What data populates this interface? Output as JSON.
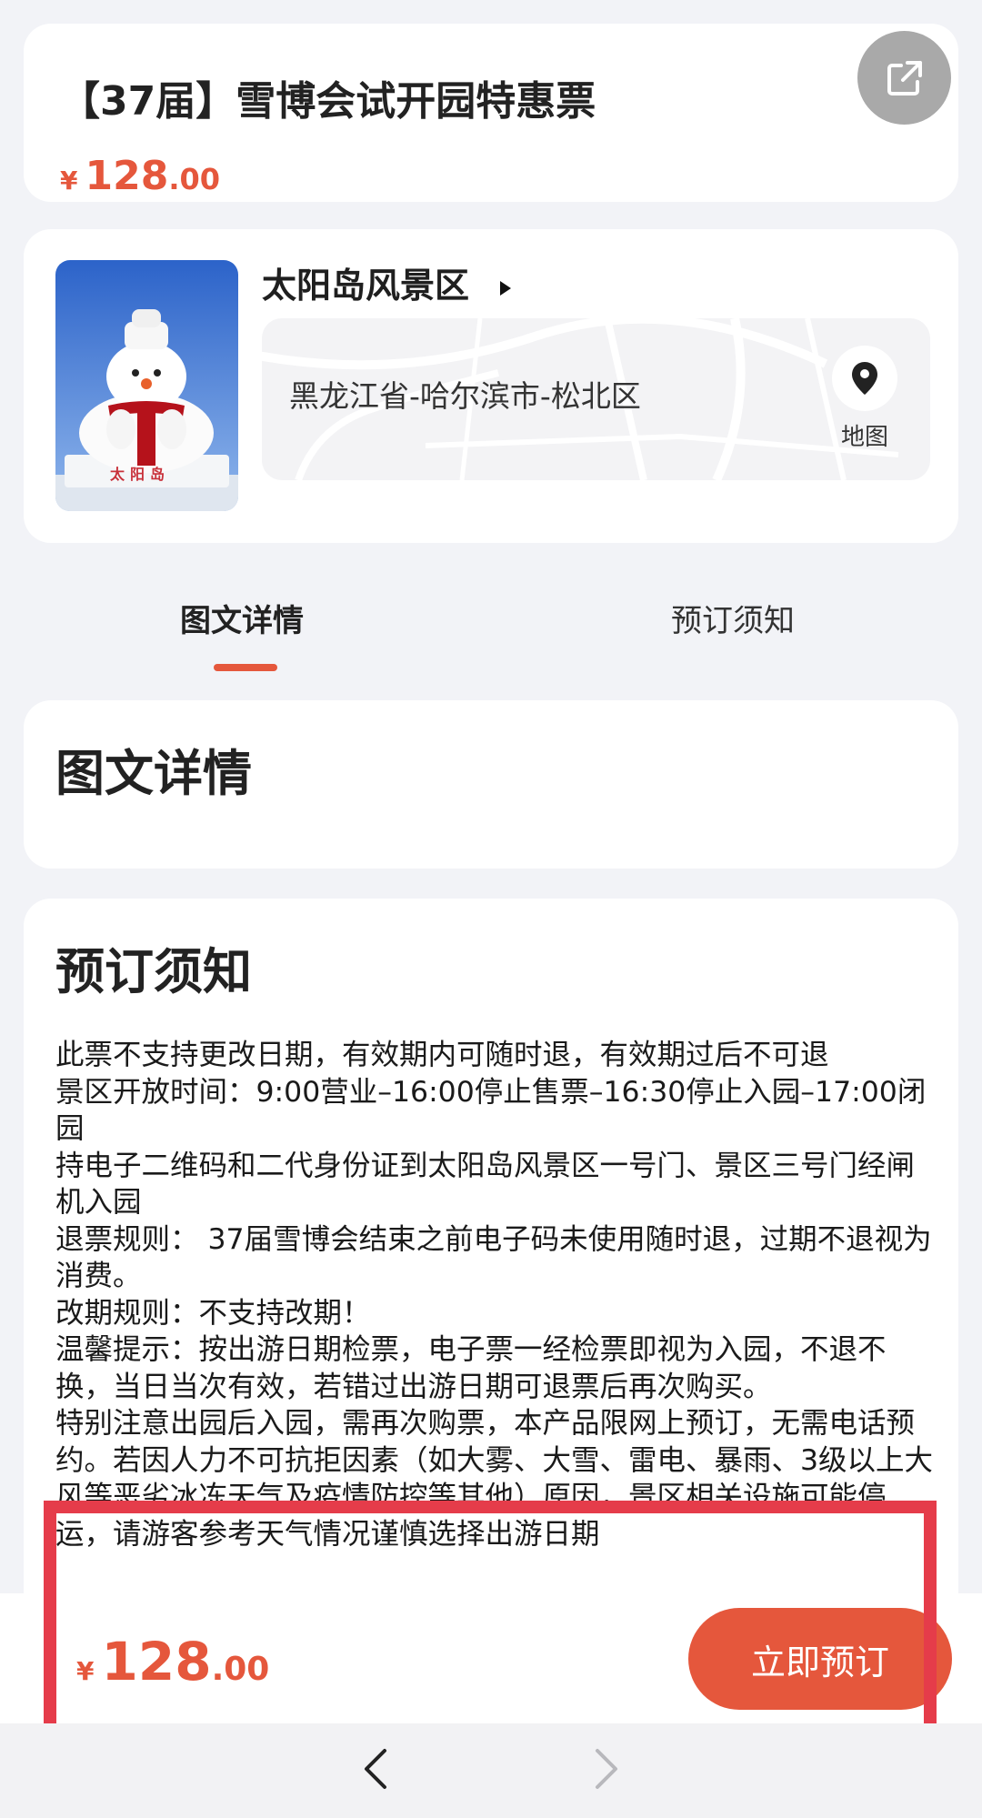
{
  "header": {
    "title": "【37届】雪博会试开园特惠票",
    "price": {
      "currency": "¥",
      "integer": "128",
      "decimal": ".00"
    },
    "share_icon": "share-external-icon"
  },
  "scenic": {
    "name": "太阳岛风景区",
    "address": "黑龙江省-哈尔滨市-松北区",
    "map_label": "地图",
    "photo_caption": "太阳岛"
  },
  "tabs": [
    {
      "label": "图文详情",
      "active": true
    },
    {
      "label": "预订须知",
      "active": false
    }
  ],
  "detail_section": {
    "title": "图文详情"
  },
  "notice_section": {
    "title": "预订须知",
    "lines": [
      "此票不支持更改日期，有效期内可随时退，有效期过后不可退",
      "景区开放时间：9:00营业–16:00停止售票–16:30停止入园–17:00闭园",
      "持电子二维码和二代身份证到太阳岛风景区一号门、景区三号门经闸机入园",
      "退票规则： 37届雪博会结束之前电子码未使用随时退，过期不退视为消费。",
      "改期规则：不支持改期！",
      "温馨提示：按出游日期检票，电子票一经检票即视为入园，不退不换，当日当次有效，若错过出游日期可退票后再次购买。",
      "特别注意出园后入园，需再次购票，本产品限网上预订，无需电话预约。若因人力不可抗拒因素（如大雾、大雪、雷电、暴雨、3级以上大风等恶劣冰冻天气及疫情防控等其他）原因，景区相关设施可能停运，请游客参考天气情况谨慎选择出游日期"
    ]
  },
  "bottom_bar": {
    "price": {
      "currency": "¥",
      "integer": "128",
      "decimal": ".00"
    },
    "book_label": "立即预订"
  },
  "colors": {
    "accent": "#e5573c",
    "highlight_border": "#e53c4a",
    "background": "#f2f3f7"
  }
}
